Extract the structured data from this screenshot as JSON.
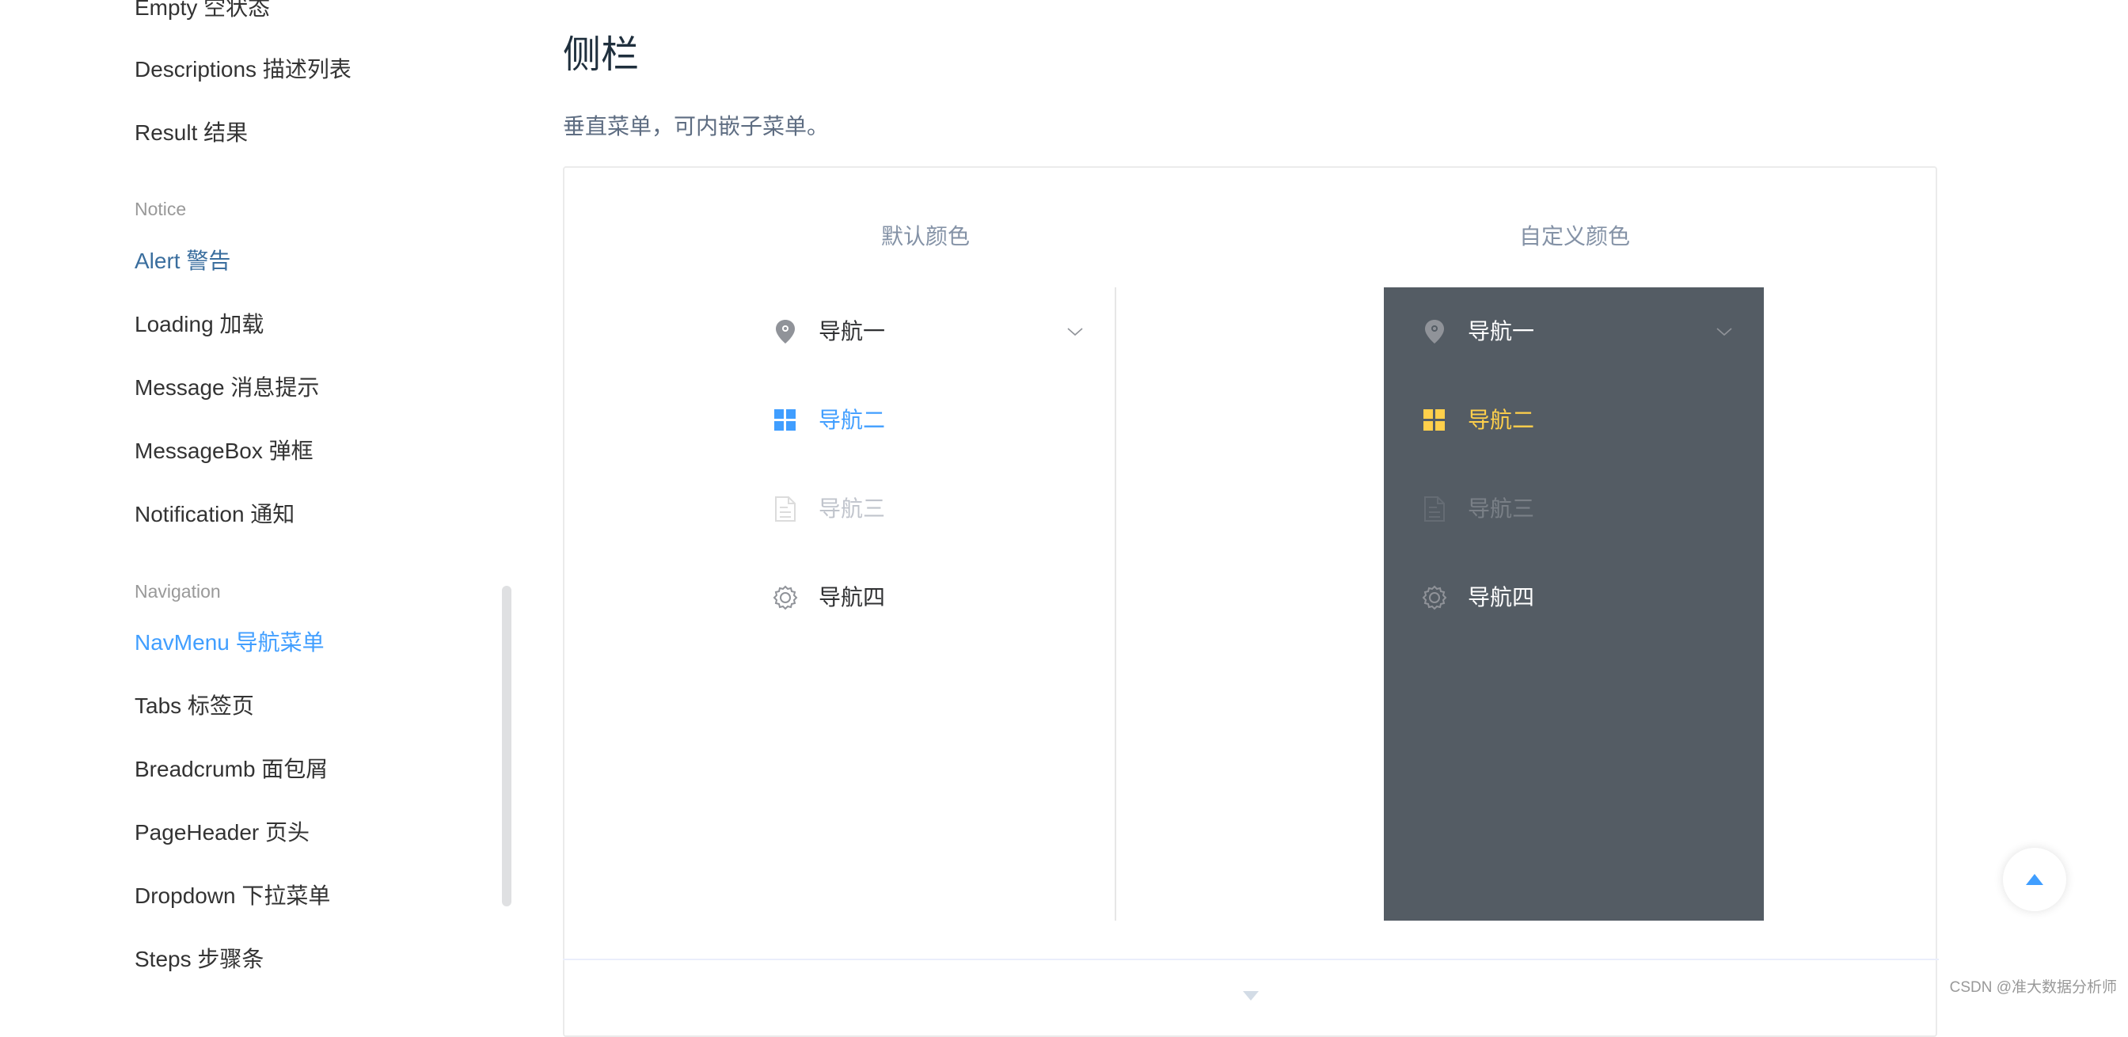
{
  "sidebar": {
    "items": [
      {
        "label": "Empty 空状态",
        "type": "item"
      },
      {
        "label": "Descriptions 描述列表",
        "type": "item"
      },
      {
        "label": "Result 结果",
        "type": "item"
      },
      {
        "label": "Notice",
        "type": "group"
      },
      {
        "label": "Alert 警告",
        "type": "item"
      },
      {
        "label": "Loading 加载",
        "type": "item"
      },
      {
        "label": "Message 消息提示",
        "type": "item"
      },
      {
        "label": "MessageBox 弹框",
        "type": "item"
      },
      {
        "label": "Notification 通知",
        "type": "item"
      },
      {
        "label": "Navigation",
        "type": "group"
      },
      {
        "label": "NavMenu 导航菜单",
        "type": "item",
        "active": true
      },
      {
        "label": "Tabs 标签页",
        "type": "item"
      },
      {
        "label": "Breadcrumb 面包屑",
        "type": "item"
      },
      {
        "label": "PageHeader 页头",
        "type": "item"
      },
      {
        "label": "Dropdown 下拉菜单",
        "type": "item"
      },
      {
        "label": "Steps 步骤条",
        "type": "item"
      }
    ]
  },
  "main": {
    "title": "侧栏",
    "description": "垂直菜单，可内嵌子菜单。",
    "demo": {
      "default_column_title": "默认颜色",
      "custom_column_title": "自定义颜色",
      "default_menu": {
        "background": "#ffffff",
        "text_color": "#303133",
        "active_color": "#409eff",
        "items": [
          {
            "label": "导航一",
            "icon": "location-icon",
            "submenu": true,
            "state": "normal"
          },
          {
            "label": "导航二",
            "icon": "menu-grid-icon",
            "state": "active"
          },
          {
            "label": "导航三",
            "icon": "document-icon",
            "state": "disabled"
          },
          {
            "label": "导航四",
            "icon": "setting-icon",
            "state": "normal"
          }
        ]
      },
      "custom_menu": {
        "background": "#545c64",
        "text_color": "#ffffff",
        "active_color": "#ffd04b",
        "items": [
          {
            "label": "导航一",
            "icon": "location-icon",
            "submenu": true,
            "state": "normal"
          },
          {
            "label": "导航二",
            "icon": "menu-grid-icon",
            "state": "active"
          },
          {
            "label": "导航三",
            "icon": "document-icon",
            "state": "disabled"
          },
          {
            "label": "导航四",
            "icon": "setting-icon",
            "state": "normal"
          }
        ]
      }
    }
  },
  "back_to_top": {
    "icon": "caret-top-icon"
  },
  "expand_code": {
    "icon": "caret-bottom-icon"
  },
  "watermark": "CSDN @准大数据分析师"
}
